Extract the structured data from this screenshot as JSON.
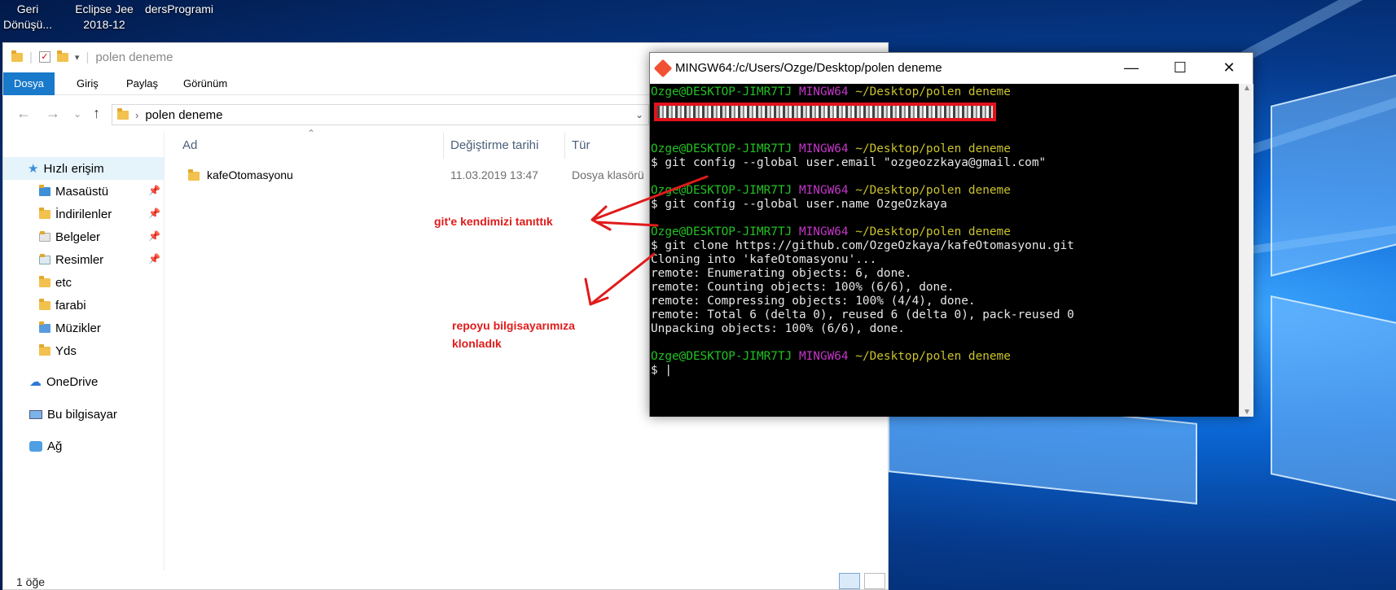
{
  "desktop": {
    "icons": [
      {
        "line1": "Geri",
        "line2": "Dönüşü..."
      },
      {
        "line1": "Eclipse Jee",
        "line2": "2018-12"
      },
      {
        "line1": "dersProgrami",
        "line2": ""
      }
    ]
  },
  "explorer": {
    "qat_title": "polen deneme",
    "ribbon_tabs": [
      "Dosya",
      "Giriş",
      "Paylaş",
      "Görünüm"
    ],
    "address": "polen deneme",
    "sidebar": [
      {
        "label": "Hızlı erişim",
        "icon": "star-icon"
      },
      {
        "label": "Masaüstü",
        "icon": "desktop-folder-icon"
      },
      {
        "label": "İndirilenler",
        "icon": "downloads-folder-icon"
      },
      {
        "label": "Belgeler",
        "icon": "documents-folder-icon"
      },
      {
        "label": "Resimler",
        "icon": "pictures-folder-icon"
      },
      {
        "label": "etc",
        "icon": "folder-icon"
      },
      {
        "label": "farabi",
        "icon": "folder-icon"
      },
      {
        "label": "Müzikler",
        "icon": "music-folder-icon"
      },
      {
        "label": "Yds",
        "icon": "folder-icon"
      },
      {
        "label": "OneDrive",
        "icon": "cloud-icon"
      },
      {
        "label": "Bu bilgisayar",
        "icon": "computer-icon"
      },
      {
        "label": "Ağ",
        "icon": "network-icon"
      }
    ],
    "columns": {
      "name": "Ad",
      "date": "Değiştirme tarihi",
      "type": "Tür"
    },
    "files": [
      {
        "name": "kafeOtomasyonu",
        "date": "11.03.2019 13:47",
        "type": "Dosya klasörü"
      }
    ],
    "status": "1 öğe"
  },
  "terminal": {
    "title": "MINGW64:/c/Users/Ozge/Desktop/polen deneme",
    "user": "Ozge@DESKTOP-JIMR7TJ",
    "shell": "MINGW64",
    "path": "~/Desktop/polen deneme",
    "cmd1": "$ git config --global user.email \"ozgeozzkaya@gmail.com\"",
    "cmd2": "$ git config --global user.name OzgeOzkaya",
    "cmd3": "$ git clone https://github.com/OzgeOzkaya/kafeOtomasyonu.git",
    "out1": "Cloning into 'kafeOtomasyonu'...",
    "out2": "remote: Enumerating objects: 6, done.",
    "out3": "remote: Counting objects: 100% (6/6), done.",
    "out4": "remote: Compressing objects: 100% (4/4), done.",
    "out5": "remote: Total 6 (delta 0), reused 6 (delta 0), pack-reused 0",
    "out6": "Unpacking objects: 100% (6/6), done.",
    "prompt": "$ |"
  },
  "annotations": {
    "note1": "git'e kendimizi tanıttık",
    "note2_line1": "repoyu bilgisayarımıza",
    "note2_line2": "klonladık"
  },
  "colors": {
    "accent": "#1979ca",
    "annotation_red": "#e01b1b",
    "terminal_green": "#21c221",
    "terminal_magenta": "#c336c8",
    "terminal_yellow": "#c9c22c"
  }
}
